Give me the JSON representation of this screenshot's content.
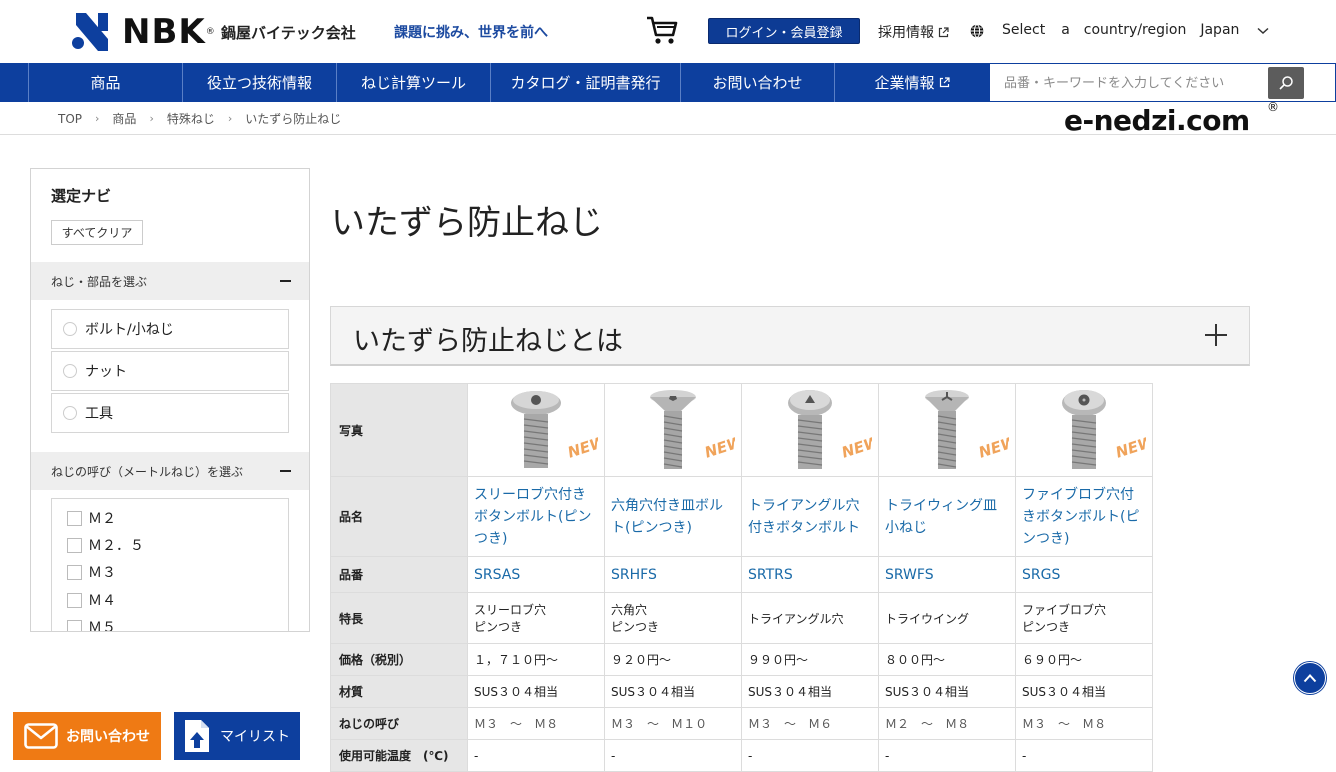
{
  "header": {
    "logo_text": "NBK",
    "company_name": "鍋屋バイテック会社",
    "tagline": "課題に挑み、世界を前へ",
    "login_label": "ログイン・会員登録",
    "recruit_label": "採用情報",
    "country_words": [
      "Select",
      "a",
      "country/region",
      "Japan"
    ]
  },
  "nav": {
    "items": [
      "商品",
      "役立つ技術情報",
      "ねじ計算ツール",
      "カタログ・証明書発行",
      "お問い合わせ",
      "企業情報"
    ],
    "search_placeholder": "品番・キーワードを入力してください"
  },
  "breadcrumb": [
    "TOP",
    "商品",
    "特殊ねじ",
    "いたずら防止ねじ"
  ],
  "brand": {
    "name": "e-nedzi.com",
    "reg": "®"
  },
  "sidebar": {
    "title": "選定ナビ",
    "clear_label": "すべてクリア",
    "section1": "ねじ・部品を選ぶ",
    "radio_options": [
      "ボルト/小ねじ",
      "ナット",
      "工具"
    ],
    "section2": "ねじの呼び（メートルねじ）を選ぶ",
    "check_options": [
      "Ｍ２",
      "Ｍ２．５",
      "Ｍ３",
      "Ｍ４",
      "Ｍ５"
    ]
  },
  "main": {
    "title": "いたずら防止ねじ",
    "accordion_title": "いたずら防止ねじとは",
    "new_badge": "NEW"
  },
  "table": {
    "row_labels": [
      "写真",
      "品名",
      "品番",
      "特長",
      "価格（税別）",
      "材質",
      "ねじの呼び",
      "使用可能温度　(℃)"
    ],
    "products": [
      {
        "name": "スリーロブ穴付きボタンボルト(ピンつき)",
        "code": "SRSAS",
        "feature1": "スリーロブ穴",
        "feature2": "ピンつき",
        "price": "１，７１０円〜",
        "material": "SUS３０４相当",
        "size_from": "Ｍ３",
        "size_to": "Ｍ８",
        "temp": "-"
      },
      {
        "name": "六角穴付き皿ボルト(ピンつき)",
        "code": "SRHFS",
        "feature1": "六角穴",
        "feature2": "ピンつき",
        "price": "９２０円〜",
        "material": "SUS３０４相当",
        "size_from": "Ｍ３",
        "size_to": "Ｍ１０",
        "temp": "-"
      },
      {
        "name": "トライアングル穴付きボタンボルト",
        "code": "SRTRS",
        "feature1": "トライアングル穴",
        "feature2": "",
        "price": "９９０円〜",
        "material": "SUS３０４相当",
        "size_from": "Ｍ３",
        "size_to": "Ｍ６",
        "temp": "-"
      },
      {
        "name": "トライウィング皿小ねじ",
        "code": "SRWFS",
        "feature1": "トライウイング",
        "feature2": "",
        "price": "８００円〜",
        "material": "SUS３０４相当",
        "size_from": "Ｍ２",
        "size_to": "Ｍ８",
        "temp": "-"
      },
      {
        "name": "ファイブロブ穴付きボタンボルト(ピンつき)",
        "code": "SRGS",
        "feature1": "ファイブロブ穴",
        "feature2": "ピンつき",
        "price": "６９０円〜",
        "material": "SUS３０４相当",
        "size_from": "Ｍ３",
        "size_to": "Ｍ８",
        "temp": "-"
      }
    ],
    "range_sep": "〜"
  },
  "floating": {
    "contact_label": "お問い合わせ",
    "mylist_label": "マイリスト"
  },
  "colors": {
    "brand_blue": "#0d3f9e",
    "contact_orange": "#ef7a14",
    "link_blue": "#1a6aa8",
    "new_orange": "#f0a35a"
  }
}
